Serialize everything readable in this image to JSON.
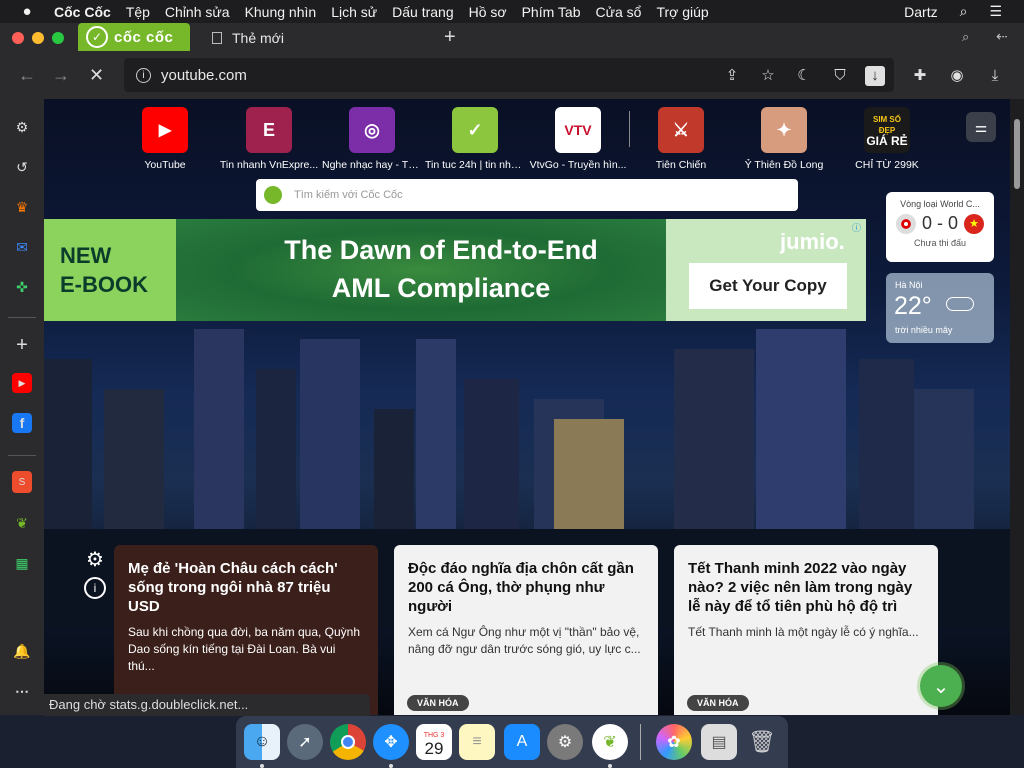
{
  "menubar": {
    "apple": "",
    "app_name": "Cốc Cốc",
    "items": [
      "Tệp",
      "Chỉnh sửa",
      "Khung nhìn",
      "Lịch sử",
      "Dấu trang",
      "Hồ sơ",
      "Phím Tab",
      "Cửa sổ",
      "Trợ giúp"
    ],
    "user": "Dartz"
  },
  "tabs": {
    "brand_tab": "cốc cốc",
    "active_tab": "Thẻ mới"
  },
  "toolbar": {
    "url": "youtube.com"
  },
  "speed_dial": [
    {
      "label": "YouTube",
      "color": "#ff0000",
      "icon": "youtube-icon"
    },
    {
      "label": "Tin nhanh VnExpre...",
      "color": "#9f224e",
      "icon": "vnexpress-icon"
    },
    {
      "label": "Nghe nhạc hay - Tả...",
      "color": "#7b2ea8",
      "icon": "music-icon"
    },
    {
      "label": "Tin tuc 24h | tin nha...",
      "color": "#8cc63e",
      "icon": "news-icon"
    },
    {
      "label": "VtvGo - Truyền hìn...",
      "color": "#ffffff",
      "icon": "vtvgo-icon"
    },
    {
      "label": "Tiên Chiến",
      "color": "#c0392b",
      "icon": "game-icon"
    },
    {
      "label": "Ỷ Thiên Đồ Long",
      "color": "#d79b7e",
      "icon": "game-icon"
    },
    {
      "label": "CHỈ TỪ 299K",
      "color": "#1a1a1a",
      "icon": "sim-icon"
    }
  ],
  "sim_tile": {
    "line1": "SIM SỐ ĐẸP",
    "line2": "GIÁ RẺ"
  },
  "search": {
    "placeholder": "Tìm kiếm với Cốc Cốc"
  },
  "ad": {
    "left_text_1": "NEW",
    "left_text_2": "E-BOOK",
    "headline_1": "The Dawn of End-to-End",
    "headline_2": "AML Compliance",
    "brand": "jumio.",
    "cta": "Get Your Copy"
  },
  "world_cup": {
    "title": "Vòng loại World C...",
    "score": "0 - 0",
    "status": "Chưa thi đấu"
  },
  "weather": {
    "city": "Hà Nội",
    "temp": "22°",
    "desc": "trời nhiều mây"
  },
  "news": [
    {
      "title": "Mẹ đẻ 'Hoàn Châu cách cách' sống trong ngôi nhà 87 triệu USD",
      "desc": "Sau khi chồng qua đời, ba năm qua, Quỳnh Dao sống kín tiếng tại Đài Loan. Bà vui thú...",
      "tag": ""
    },
    {
      "title": "Độc đáo nghĩa địa chôn cất gần 200 cá Ông, thờ phụng như người",
      "desc": "Xem cá Ngư Ông như một vị \"thần\" bảo vệ, nâng đỡ ngư dân trước sóng gió, uy lực c...",
      "tag": "VĂN HÓA"
    },
    {
      "title": "Tết Thanh minh 2022 vào ngày nào? 2 việc nên làm trong ngày lễ này để tổ tiên phù hộ độ trì",
      "desc": "Tết Thanh minh là một ngày lễ có ý nghĩa...",
      "tag": "VĂN HÓA"
    }
  ],
  "status_bar": "Đang chờ stats.g.doubleclick.net...",
  "dock": {
    "calendar_month": "THG 3",
    "calendar_day": "29"
  }
}
